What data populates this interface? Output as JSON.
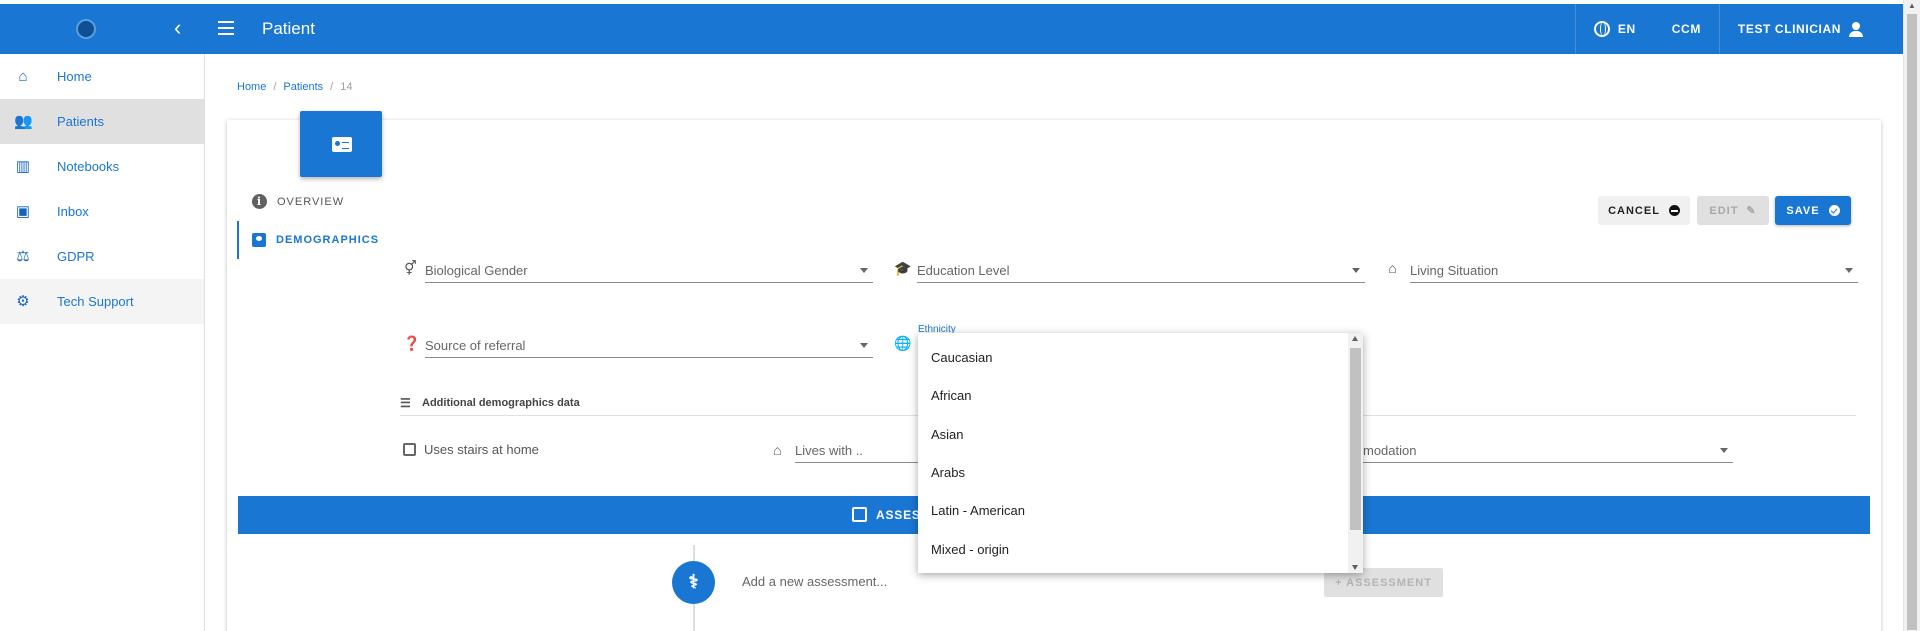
{
  "header": {
    "title": "Patient",
    "language": "EN",
    "module": "CCM",
    "user": "TEST CLINICIAN",
    "accent": "#1976d2"
  },
  "sidebar": {
    "items": [
      {
        "label": "Home",
        "icon": "home-icon"
      },
      {
        "label": "Patients",
        "icon": "people-icon"
      },
      {
        "label": "Notebooks",
        "icon": "bar-chart-icon"
      },
      {
        "label": "Inbox",
        "icon": "inbox-icon"
      },
      {
        "label": "GDPR",
        "icon": "gavel-icon"
      },
      {
        "label": "Tech Support",
        "icon": "support-icon"
      }
    ]
  },
  "breadcrumb": {
    "home": "Home",
    "patients": "Patients",
    "current": "14"
  },
  "tabs": {
    "overview": "OVERVIEW",
    "demographics": "DEMOGRAPHICS"
  },
  "actions": {
    "cancel": "CANCEL",
    "edit": "EDIT",
    "save": "SAVE"
  },
  "form": {
    "biological_gender": "Biological Gender",
    "education_level": "Education Level",
    "living_situation": "Living Situation",
    "source_of_referral": "Source of referral",
    "ethnicity_label": "Ethnicity",
    "additional_data": "Additional demographics data",
    "uses_stairs": "Uses stairs at home",
    "lives_with": "Lives with ..",
    "accommodation_fragment": "modation"
  },
  "assessments": {
    "bar_label": "ASSESS",
    "new_placeholder": "Add a new assessment...",
    "add_button": "+ ASSESSMENT"
  },
  "ethnicity_dropdown": {
    "options": [
      "Caucasian",
      "African",
      "Asian",
      "Arabs",
      "Latin - American",
      "Mixed - origin"
    ]
  }
}
